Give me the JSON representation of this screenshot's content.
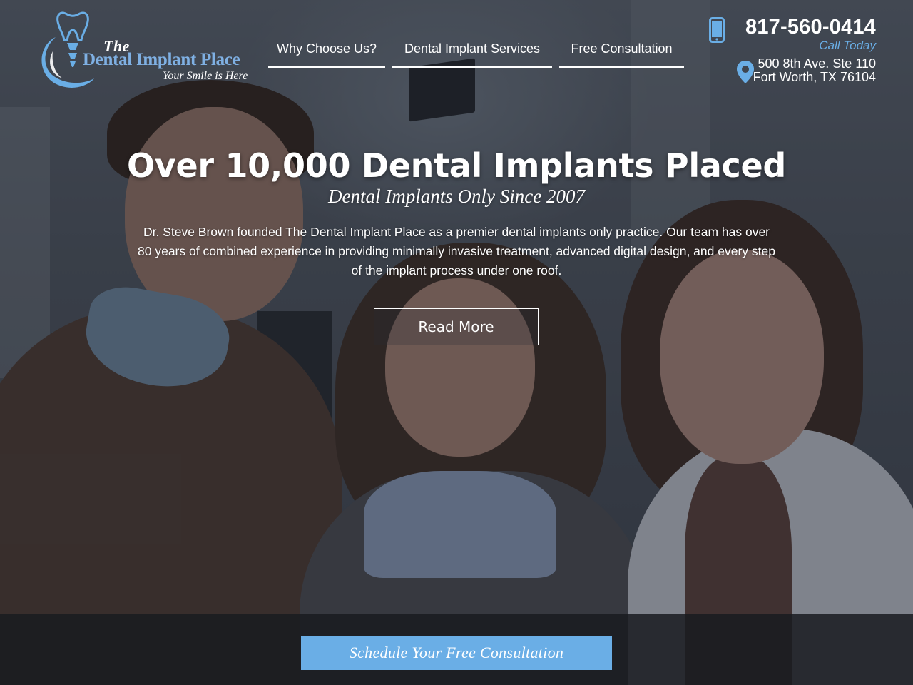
{
  "brand": {
    "the": "The",
    "name": "Dental Implant Place",
    "tagline": "Your Smile is Here",
    "accent_color": "#6aaee6"
  },
  "nav": {
    "items": [
      {
        "label": "Why Choose Us?"
      },
      {
        "label": "Dental Implant Services"
      },
      {
        "label": "Free Consultation"
      }
    ]
  },
  "contact": {
    "phone_icon": "phone-icon",
    "phone": "817-560-0414",
    "call_label": "Call Today",
    "pin_icon": "map-pin-icon",
    "address_line1": "500 8th Ave. Ste 110",
    "address_line2": "Fort Worth, TX 76104"
  },
  "hero": {
    "title": "Over 10,000 Dental Implants Placed",
    "subtitle": "Dental Implants Only Since 2007",
    "body": "Dr. Steve Brown founded The Dental Implant Place as a premier dental implants only practice. Our team has over 80 years of combined experience in providing minimally invasive treatment, advanced digital design, and every step of the implant process under one roof.",
    "button_label": "Read More"
  },
  "cta": {
    "button_label": "Schedule Your Free Consultation"
  }
}
